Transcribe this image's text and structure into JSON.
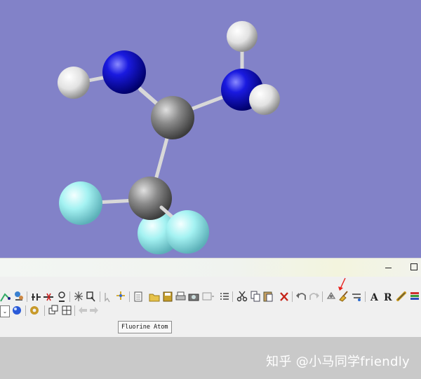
{
  "viewport": {
    "background": "#8282c8",
    "atoms": [
      {
        "name": "hydrogen-atom-top",
        "element": "H",
        "color": "#e8e8e8"
      },
      {
        "name": "nitrogen-atom-left",
        "element": "N",
        "color": "#1010d8"
      },
      {
        "name": "hydrogen-atom-left",
        "element": "H",
        "color": "#e8e8e8"
      },
      {
        "name": "nitrogen-atom-right",
        "element": "N",
        "color": "#1010d8"
      },
      {
        "name": "hydrogen-atom-right",
        "element": "H",
        "color": "#e8e8e8"
      },
      {
        "name": "carbon-atom-center",
        "element": "C",
        "color": "#909090"
      },
      {
        "name": "carbon-atom-lower",
        "element": "C",
        "color": "#909090"
      },
      {
        "name": "fluorine-atom-left",
        "element": "F",
        "color": "#9cf0f0"
      },
      {
        "name": "fluorine-atom-back",
        "element": "F",
        "color": "#9cf0f0"
      },
      {
        "name": "fluorine-atom-front",
        "element": "F",
        "color": "#9cf0f0"
      }
    ]
  },
  "window": {
    "minimize_glyph": "",
    "maximize_glyph": ""
  },
  "toolbar": {
    "row1_icons": [
      "bond-draw-icon",
      "fragment-icon",
      "ring-icon",
      "bond-break-icon",
      "cut-icon",
      "valence-icon",
      "atom-select-icon",
      "inquire-icon",
      "pointer-icon",
      "sparkle-icon",
      "new-file-icon",
      "open-icon",
      "save-icon",
      "print-icon",
      "camera-icon",
      "screenshot-icon",
      "list-icon",
      "scissors-icon",
      "copy-icon",
      "paste-icon",
      "delete-icon",
      "undo-icon",
      "redo-icon",
      "symmetry-icon",
      "clean-broom-icon",
      "rebuild-icon",
      "label-a-icon",
      "label-r-icon",
      "link-icon",
      "stack-icon"
    ],
    "row2_icons": [
      "combo-dropdown",
      "globe-icon",
      "gear-icon",
      "windows-icon",
      "grid-icon",
      "back-arrow-icon",
      "forward-arrow-icon"
    ],
    "accent_arrow_color": "#e8201c"
  },
  "tooltip": {
    "text": "Fluorine Atom"
  },
  "watermark": {
    "text": "知乎 @小马同学friendly"
  }
}
